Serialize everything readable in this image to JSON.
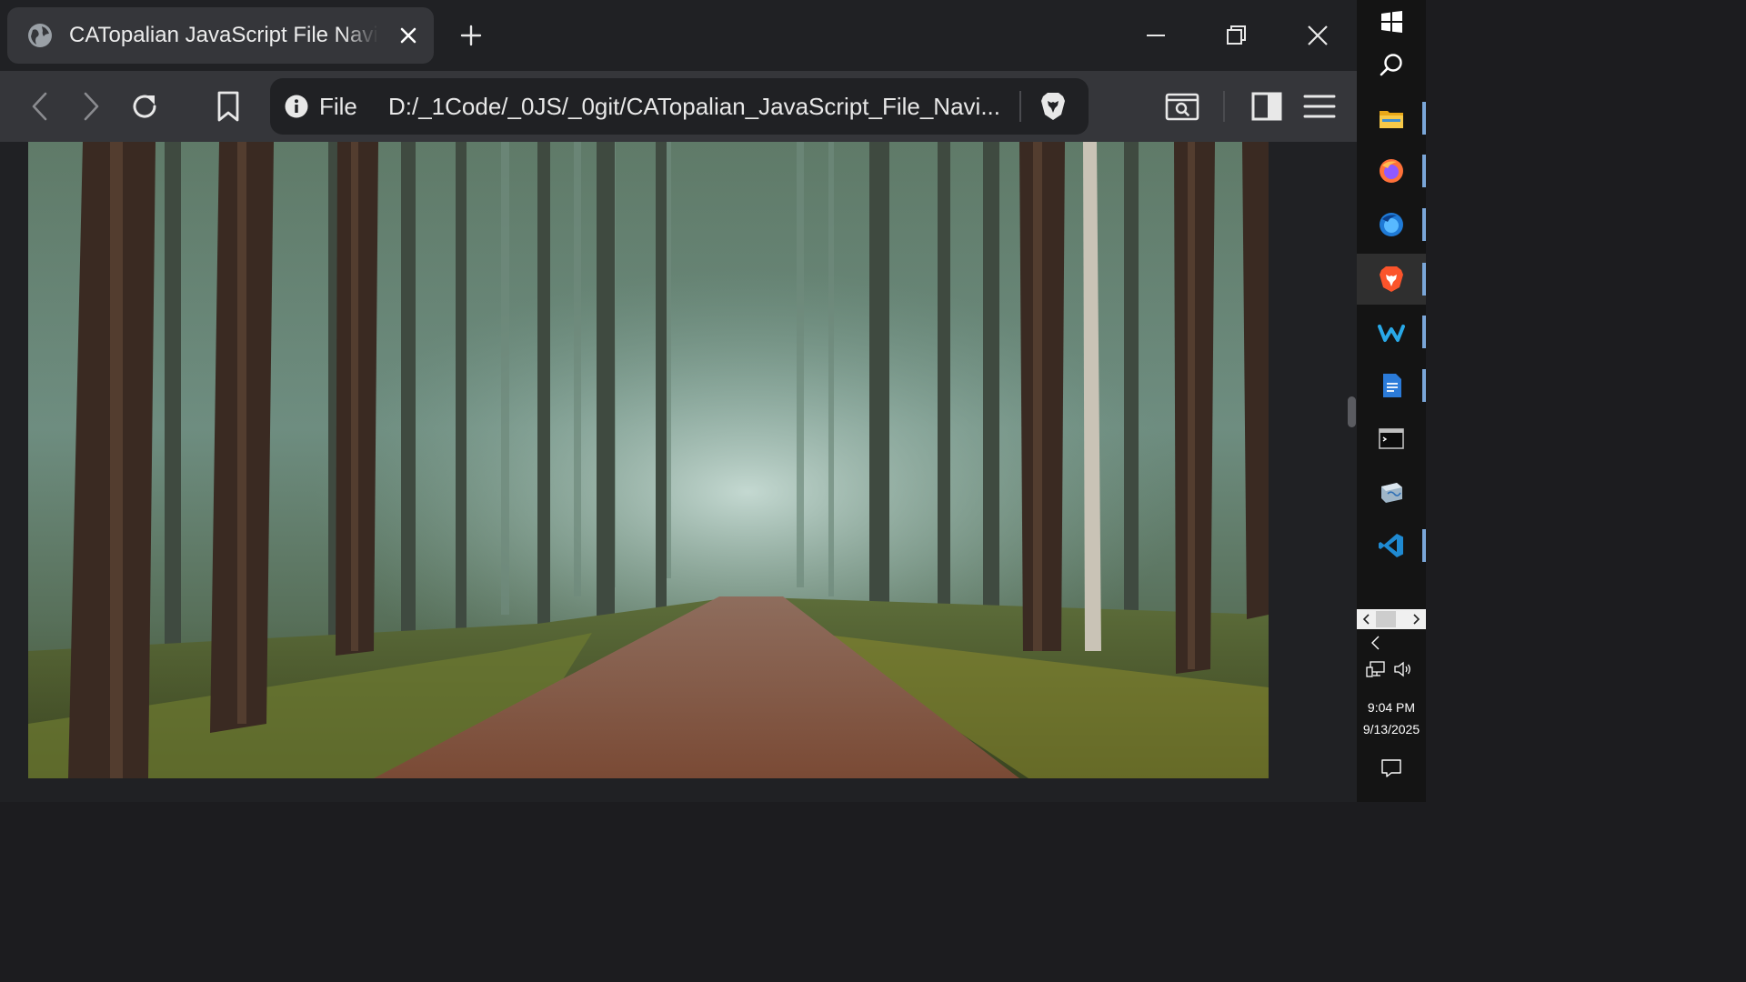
{
  "browser": {
    "tab": {
      "title": "CATopalian JavaScript File Navigator",
      "icon": "globe-icon"
    },
    "new_tab_icon": "plus-icon",
    "window_controls": [
      "minimize-icon",
      "restore-icon",
      "close-icon"
    ],
    "toolbar": {
      "back_icon": "chevron-left-icon",
      "forward_icon": "chevron-right-icon",
      "reload_icon": "reload-icon",
      "bookmark_icon": "bookmark-icon",
      "address": {
        "scheme_label": "File",
        "url": "D:/_1Code/_0JS/_0git/CATopalian_JavaScript_File_Navi...",
        "info_icon": "info-icon",
        "shields_icon": "brave-shield-icon"
      },
      "search_page_icon": "search-in-page-icon",
      "sidebar_icon": "sidebar-icon",
      "menu_icon": "hamburger-menu-icon"
    },
    "page": {
      "image_subject": "misty pine forest with dirt road"
    }
  },
  "taskbar": {
    "icons": [
      "windows-start-icon",
      "search-icon",
      "file-explorer-icon",
      "firefox-icon",
      "firefox-developer-icon",
      "brave-icon",
      "wisk-icon",
      "document-icon",
      "terminal-icon",
      "hardware-icon",
      "vscode-icon"
    ],
    "tray": {
      "expand_icon": "chevron-left-icon",
      "network_icon": "network-icon",
      "volume_icon": "volume-icon",
      "time": "9:04 PM",
      "date": "9/13/2025",
      "notification_icon": "notification-icon"
    }
  },
  "colors": {
    "tab_bar_bg": "#202124",
    "toolbar_bg": "#35363a",
    "taskbar_bg": "#141414",
    "brave_orange": "#fb542b"
  }
}
